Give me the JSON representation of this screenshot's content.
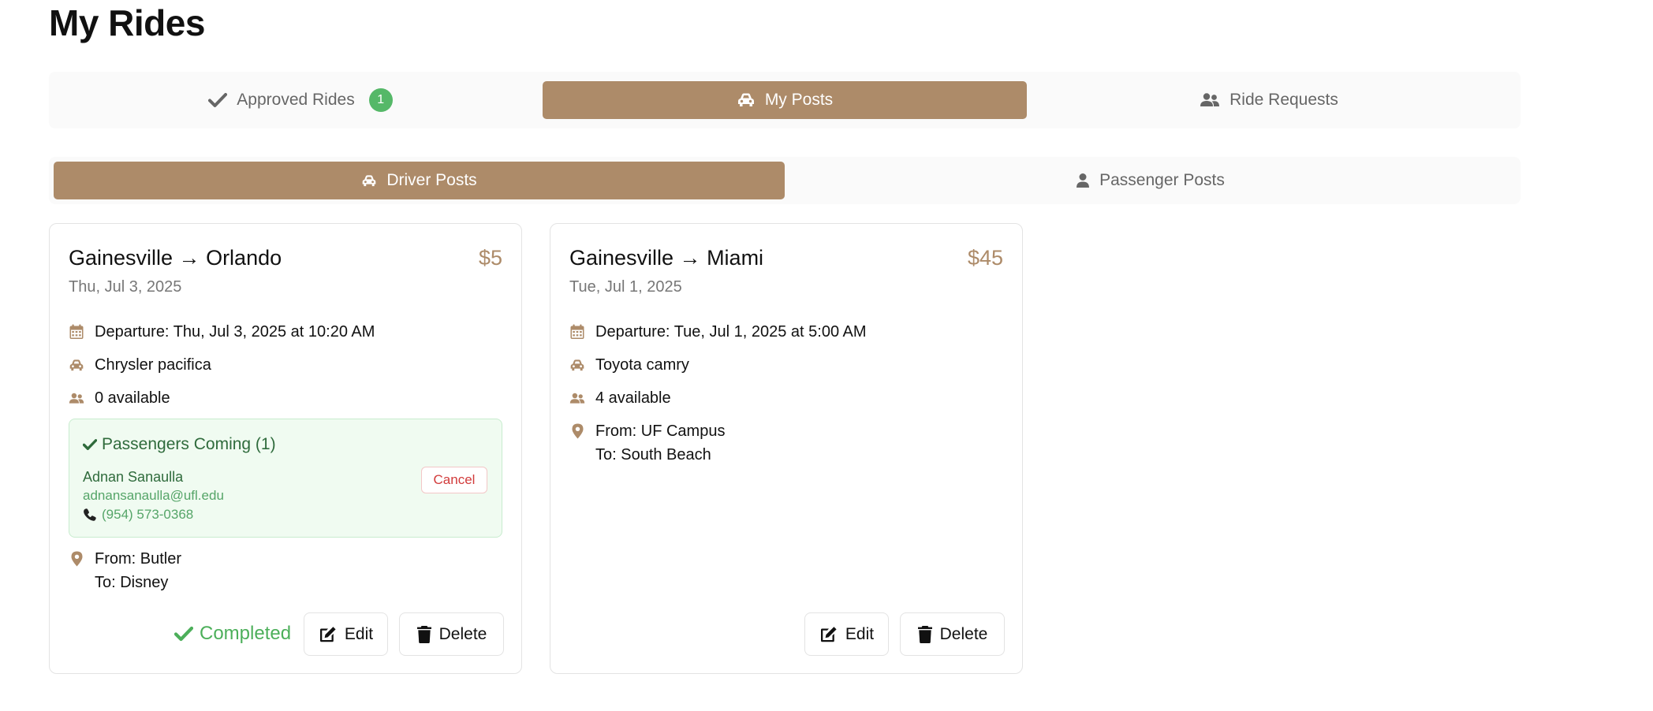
{
  "page_title": "My Rides",
  "main_tabs": [
    {
      "label": "Approved Rides",
      "icon": "check-icon",
      "badge": "1",
      "active": false
    },
    {
      "label": "My Posts",
      "icon": "car-icon",
      "active": true
    },
    {
      "label": "Ride Requests",
      "icon": "users-icon",
      "active": false
    }
  ],
  "sub_tabs": [
    {
      "label": "Driver Posts",
      "icon": "car-icon",
      "active": true
    },
    {
      "label": "Passenger Posts",
      "icon": "user-icon",
      "active": false
    }
  ],
  "colors": {
    "accent": "#ad8b69",
    "success": "#4caf5a",
    "danger": "#d23b3b"
  },
  "rides": [
    {
      "route": "Gainesville → Orlando",
      "price": "$5",
      "date": "Thu, Jul 3, 2025",
      "departure": "Departure: Thu, Jul 3, 2025 at 10:20 AM",
      "vehicle": "Chrysler pacifica",
      "seats": "0 available",
      "passengers": {
        "title": "Passengers Coming (1)",
        "name": "Adnan Sanaulla",
        "email": "adnansanaulla@ufl.edu",
        "phone": "(954) 573-0368",
        "cancel_label": "Cancel"
      },
      "from": "From: Butler",
      "to": "To: Disney",
      "status": "Completed",
      "edit_label": "Edit",
      "delete_label": "Delete"
    },
    {
      "route": "Gainesville → Miami",
      "price": "$45",
      "date": "Tue, Jul 1, 2025",
      "departure": "Departure: Tue, Jul 1, 2025 at 5:00 AM",
      "vehicle": "Toyota camry",
      "seats": "4 available",
      "from": "From: UF Campus",
      "to": "To: South Beach",
      "edit_label": "Edit",
      "delete_label": "Delete"
    }
  ]
}
